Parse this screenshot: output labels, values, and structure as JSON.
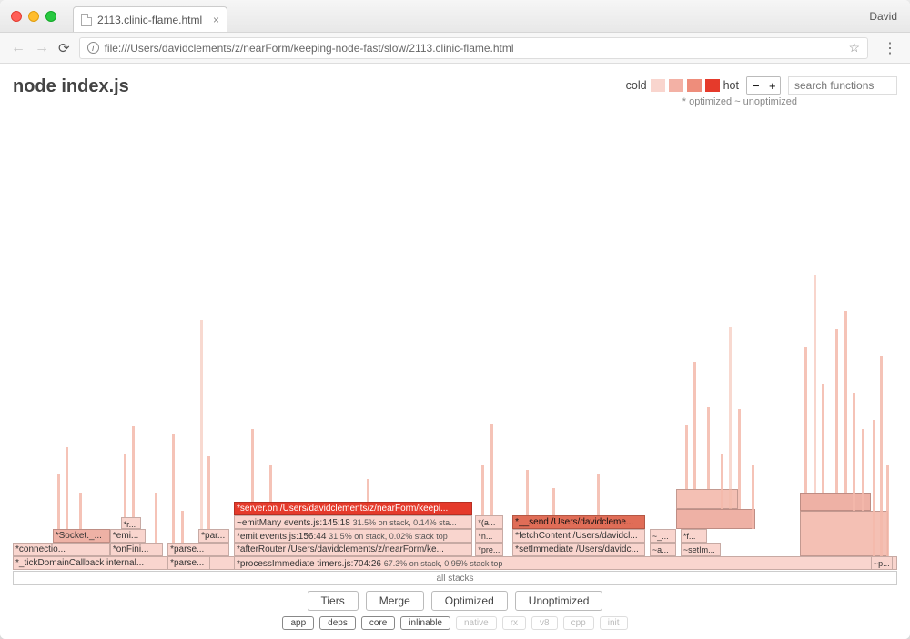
{
  "browser": {
    "user": "David",
    "tab_title": "2113.clinic-flame.html",
    "url": "file:///Users/davidclements/z/nearForm/keeping-node-fast/slow/2113.clinic-flame.html"
  },
  "header": {
    "title": "node index.js",
    "cold_label": "cold",
    "hot_label": "hot",
    "minus": "−",
    "plus": "+",
    "search_placeholder": "search functions",
    "legend_note": "* optimized ~ unoptimized"
  },
  "stack_label": "all stacks",
  "controls": {
    "buttons": {
      "tiers": "Tiers",
      "merge": "Merge",
      "optimized": "Optimized",
      "unoptimized": "Unoptimized"
    },
    "chips": {
      "app": "app",
      "deps": "deps",
      "core": "core",
      "inlinable": "inlinable",
      "native": "native",
      "rx": "rx",
      "v8": "v8",
      "cpp": "cpp",
      "init": "init"
    }
  },
  "frames": {
    "tickDomain": "*_tickDomainCallback internal...",
    "parse1": "*parse...",
    "parse3": "*parse...",
    "socket": "*Socket._...",
    "emit1": "*emi...",
    "connectio": "*connectio...",
    "onFini": "*onFini...",
    "r": "*r...",
    "par": "*par...",
    "processImmediate": "*processImmediate timers.js:704:26",
    "processImmediate_note": "67.3% on stack, 0.95% stack top",
    "afterRouter": "*afterRouter /Users/davidclements/z/nearForm/ke...",
    "emit156": "*emit events.js:156:44",
    "emit156_note": "31.5% on stack, 0.02% stack top",
    "emitMany": "~emitMany events.js:145:18",
    "emitMany_note": "31.5% on stack, 0.14% sta...",
    "serverOn": "*server.on /Users/davidclements/z/nearForm/keepi...",
    "a_anon": "*(a...",
    "pre": "*pre...",
    "n": "*n...",
    "send": "*__send /Users/davidcleme...",
    "fetchContent": "*fetchContent /Users/davidcl...",
    "setImmediate": "*setImmediate /Users/davidc...",
    "tilde": "~_...",
    "tildeA": "~a...",
    "f": "*f...",
    "setIm": "~setIm...",
    "p": "~p..."
  }
}
